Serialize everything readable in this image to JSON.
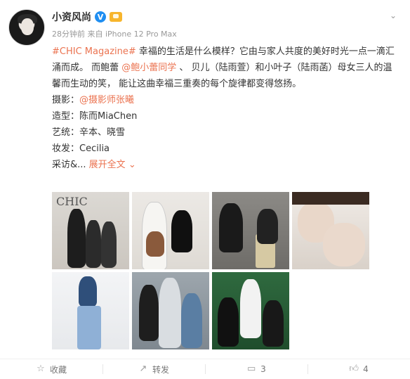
{
  "post": {
    "author": "小资风尚",
    "verified_mark": "V",
    "meta": "28分钟前 来自 iPhone 12 Pro Max",
    "topic": "#CHIC Magazine#",
    "text1": " 幸福的生活是什么模样？它由与家人共度的美好时光一点一滴汇涌而成。 而鲍蕾 ",
    "mention": "@鲍小蕾同学",
    "text2": " 、 贝儿（陆雨萱）和小叶子（陆雨菡）母女三人的温馨而生动的笑， 能让这曲幸福三重奏的每个旋律都变得悠扬。",
    "credits": {
      "photo_label": "摄影：",
      "photo_link": "@摄影师张曦",
      "styling": "造型：陈而MiaChen",
      "makeup": "艺统：辛本、晓雪",
      "hair": "妆发：Cecilia",
      "more_prefix": "采访&... ",
      "expand": "展开全文",
      "expand_icon": "chevron-down-icon"
    },
    "photo_overlay_text": "CHIC"
  },
  "actions": {
    "collect": "收藏",
    "repost": "转发",
    "comment": "3",
    "like": "4"
  },
  "colors": {
    "link": "#eb7350",
    "meta": "#999999",
    "text": "#333333"
  }
}
